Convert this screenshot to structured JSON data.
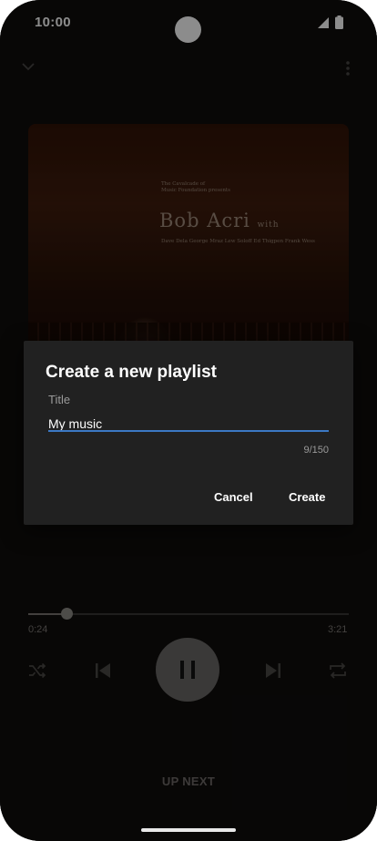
{
  "status_bar": {
    "time": "10:00"
  },
  "album_art": {
    "line1": "The Cavalcade of",
    "line2": "Music Foundation presents",
    "artist": "Bob Acri",
    "with": "with",
    "personnel": "Dave Dela  George Mraz  Lew Soloff  Ed Thigpen  Frank Wess"
  },
  "player": {
    "elapsed": "0:24",
    "total": "3:21",
    "progress": 0.12,
    "up_next": "UP NEXT"
  },
  "dialog": {
    "title": "Create a new playlist",
    "field_label": "Title",
    "field_value": "My music",
    "char_count": "9/150",
    "cancel_label": "Cancel",
    "create_label": "Create"
  },
  "colors": {
    "accent": "#3b78c4",
    "dialog_bg": "#212121",
    "screen_bg": "#0f0d0c"
  },
  "icons": [
    "chevron-down-icon",
    "more-vert-icon",
    "shuffle-icon",
    "skip-previous-icon",
    "pause-icon",
    "skip-next-icon",
    "repeat-icon",
    "signal-icon",
    "battery-icon"
  ]
}
